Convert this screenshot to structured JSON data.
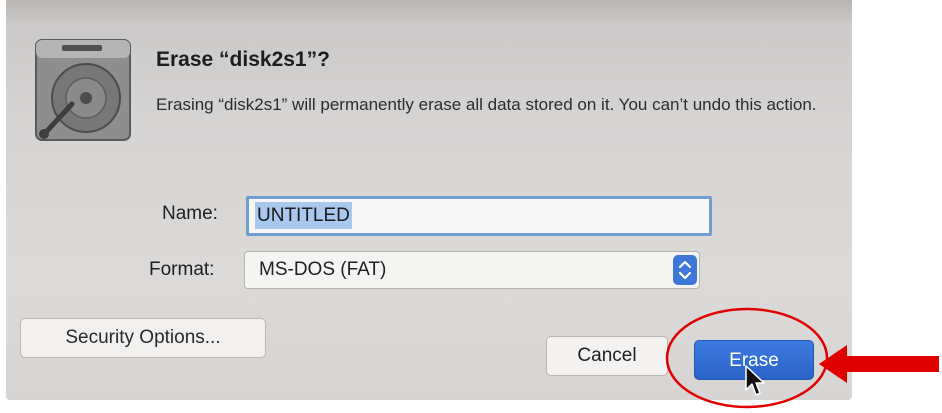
{
  "dialog": {
    "title": "Erase “disk2s1”?",
    "message": "Erasing “disk2s1” will permanently erase all data stored on it. You can’t undo this action.",
    "icon": "hard-disk-icon"
  },
  "form": {
    "name_label": "Name:",
    "name_value": "UNTITLED",
    "format_label": "Format:",
    "format_value": "MS-DOS (FAT)"
  },
  "buttons": {
    "security_options": "Security Options...",
    "cancel": "Cancel",
    "erase": "Erase"
  },
  "colors": {
    "accent": "#2f6bd6",
    "annotation": "#e00000"
  }
}
